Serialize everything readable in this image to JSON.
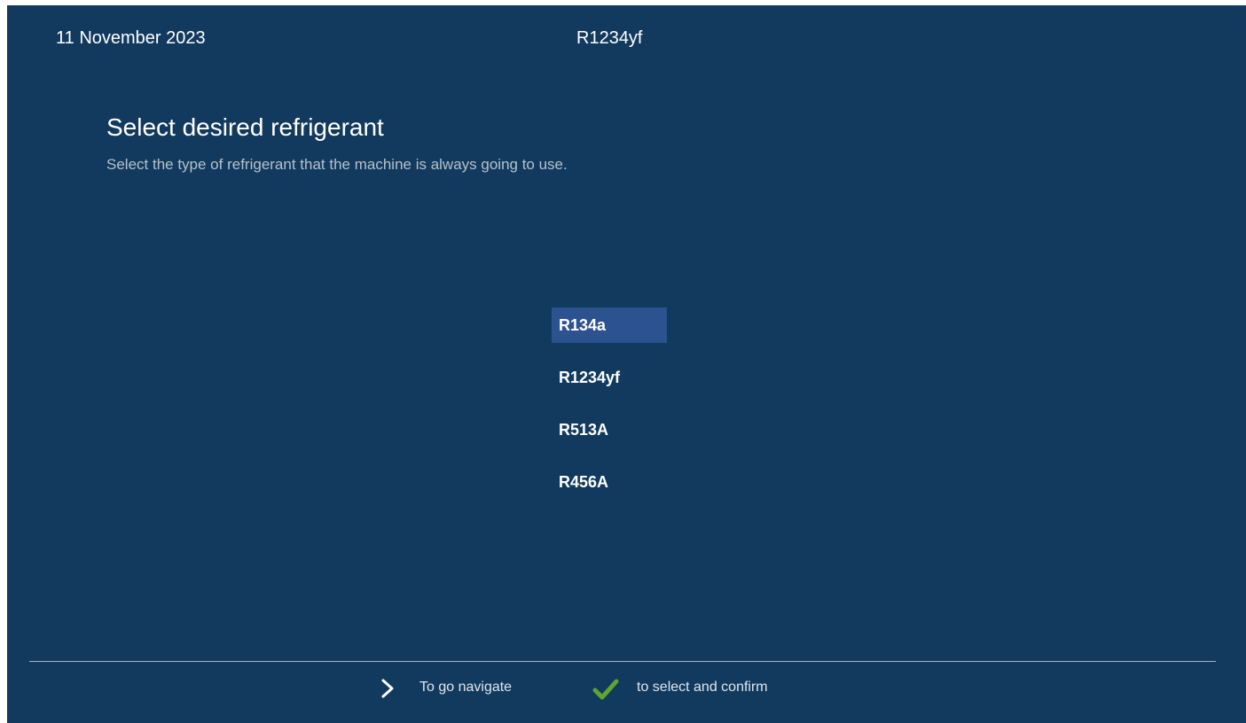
{
  "header": {
    "date": "11 November 2023",
    "current_refrigerant": "R1234yf"
  },
  "main": {
    "title": "Select desired refrigerant",
    "subtitle": "Select the type of refrigerant that the machine is always going to use.",
    "options": [
      {
        "label": "R134a",
        "selected": true
      },
      {
        "label": "R1234yf",
        "selected": false
      },
      {
        "label": "R513A",
        "selected": false
      },
      {
        "label": "R456A",
        "selected": false
      }
    ]
  },
  "footer": {
    "navigate_icon": "chevron-right-icon",
    "navigate_label": "To go navigate",
    "confirm_icon": "check-icon",
    "confirm_label": "to select and confirm"
  },
  "colors": {
    "background": "#123a5e",
    "selection": "#2d5290",
    "check": "#5fa52f"
  }
}
